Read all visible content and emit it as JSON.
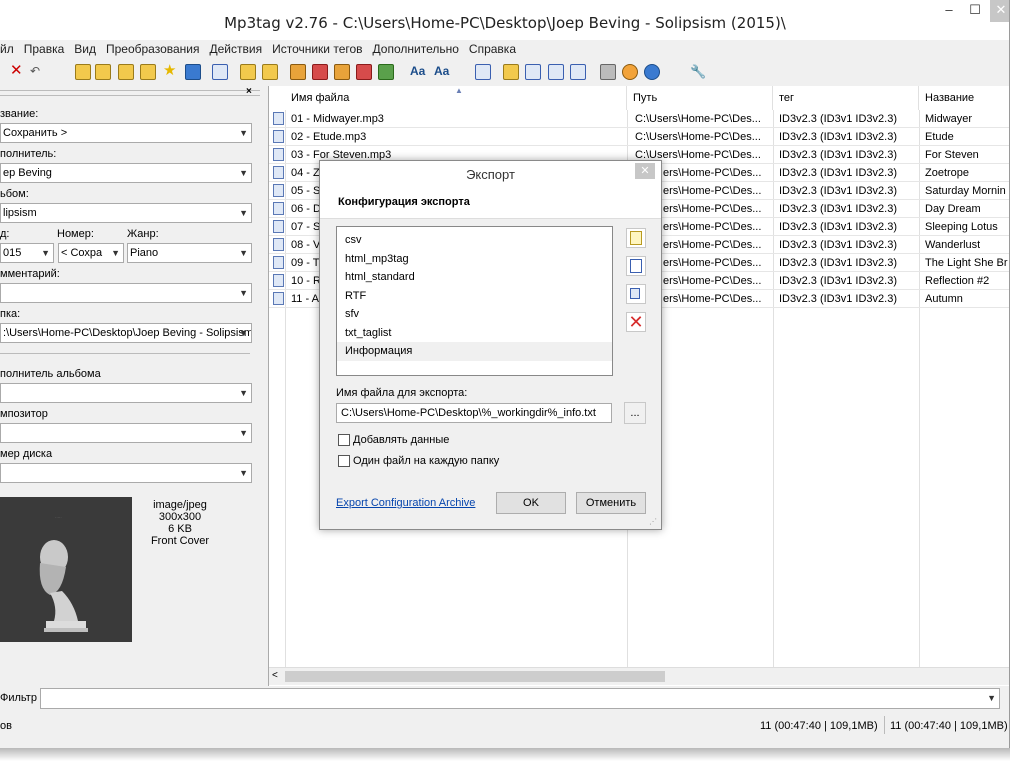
{
  "window": {
    "title": "Mp3tag v2.76  -  C:\\Users\\Home-PC\\Desktop\\Joep Beving - Solipsism (2015)\\",
    "minimize": "–",
    "maximize": "☐",
    "close": "✕"
  },
  "menu": [
    "йл",
    "Правка",
    "Вид",
    "Преобразования",
    "Действия",
    "Источники тегов",
    "Дополнительно",
    "Справка"
  ],
  "left": {
    "title_label": "звание:",
    "title_value": "Сохранить >",
    "artist_label": "полнитель:",
    "artist_value": "ep Beving",
    "album_label": "ьбом:",
    "album_value": "lipsism",
    "year_label": "д:",
    "year_value": "015",
    "track_label": "Номер:",
    "track_value": "< Сохра",
    "genre_label": "Жанр:",
    "genre_value": "Piano",
    "comment_label": "мментарий:",
    "comment_value": "",
    "folder_label": "пка:",
    "folder_value": ":\\Users\\Home-PC\\Desktop\\Joep Beving - Solipsism",
    "albumartist_label": "полнитель альбома",
    "composer_label": "мпозитор",
    "disc_label": "мер диска",
    "cover_mime": "image/jpeg",
    "cover_size": "300x300",
    "cover_kb": "6 KB",
    "cover_type": "Front Cover"
  },
  "columns": [
    "Имя файла",
    "Путь",
    "тег",
    "Название"
  ],
  "files": [
    {
      "name": "01 - Midwayer.mp3",
      "path": "C:\\Users\\Home-PC\\Des...",
      "tag": "ID3v2.3 (ID3v1 ID3v2.3)",
      "title": "Midwayer"
    },
    {
      "name": "02 - Etude.mp3",
      "path": "C:\\Users\\Home-PC\\Des...",
      "tag": "ID3v2.3 (ID3v1 ID3v2.3)",
      "title": "Etude"
    },
    {
      "name": "03 - For Steven.mp3",
      "path": "C:\\Users\\Home-PC\\Des...",
      "tag": "ID3v2.3 (ID3v1 ID3v2.3)",
      "title": "For Steven"
    },
    {
      "name": "04 - Z",
      "path": "ers\\Home-PC\\Des...",
      "tag": "ID3v2.3 (ID3v1 ID3v2.3)",
      "title": "Zoetrope"
    },
    {
      "name": "05 - S",
      "path": "ers\\Home-PC\\Des...",
      "tag": "ID3v2.3 (ID3v1 ID3v2.3)",
      "title": "Saturday Mornin"
    },
    {
      "name": "06 - D",
      "path": "ers\\Home-PC\\Des...",
      "tag": "ID3v2.3 (ID3v1 ID3v2.3)",
      "title": "Day Dream"
    },
    {
      "name": "07 - S",
      "path": "ers\\Home-PC\\Des...",
      "tag": "ID3v2.3 (ID3v1 ID3v2.3)",
      "title": "Sleeping Lotus"
    },
    {
      "name": "08 - V",
      "path": "ers\\Home-PC\\Des...",
      "tag": "ID3v2.3 (ID3v1 ID3v2.3)",
      "title": "Wanderlust"
    },
    {
      "name": "09 - T",
      "path": "ers\\Home-PC\\Des...",
      "tag": "ID3v2.3 (ID3v1 ID3v2.3)",
      "title": "The Light She Br"
    },
    {
      "name": "10 - R",
      "path": "ers\\Home-PC\\Des...",
      "tag": "ID3v2.3 (ID3v1 ID3v2.3)",
      "title": "Reflection #2"
    },
    {
      "name": "11 - A",
      "path": "ers\\Home-PC\\Des...",
      "tag": "ID3v2.3 (ID3v1 ID3v2.3)",
      "title": "Autumn"
    }
  ],
  "filter": {
    "label": "Фильтр",
    "value": ""
  },
  "status": {
    "left": "ов",
    "sel": "11 (00:47:40 | 109,1MB)",
    "total": "11 (00:47:40 | 109,1MB)"
  },
  "dialog": {
    "title": "Экспорт",
    "close": "✕",
    "header": "Конфигурация экспорта",
    "configs": [
      "csv",
      "html_mp3tag",
      "html_standard",
      "RTF",
      "sfv",
      "txt_taglist",
      "Информация"
    ],
    "selected_index": 6,
    "filename_label": "Имя файла для экспорта:",
    "filename_value": "C:\\Users\\Home-PC\\Desktop\\%_workingdir%_info.txt",
    "browse": "...",
    "append_label": "Добавлять данные",
    "onefile_label": "Один файл на каждую папку",
    "append_checked": false,
    "onefile_checked": false,
    "archive_link": "Export Configuration Archive",
    "ok": "OK",
    "cancel": "Отменить"
  },
  "colors": {
    "link": "#0645ad",
    "accent": "#3a5fb0",
    "delete": "#d62b2b"
  }
}
